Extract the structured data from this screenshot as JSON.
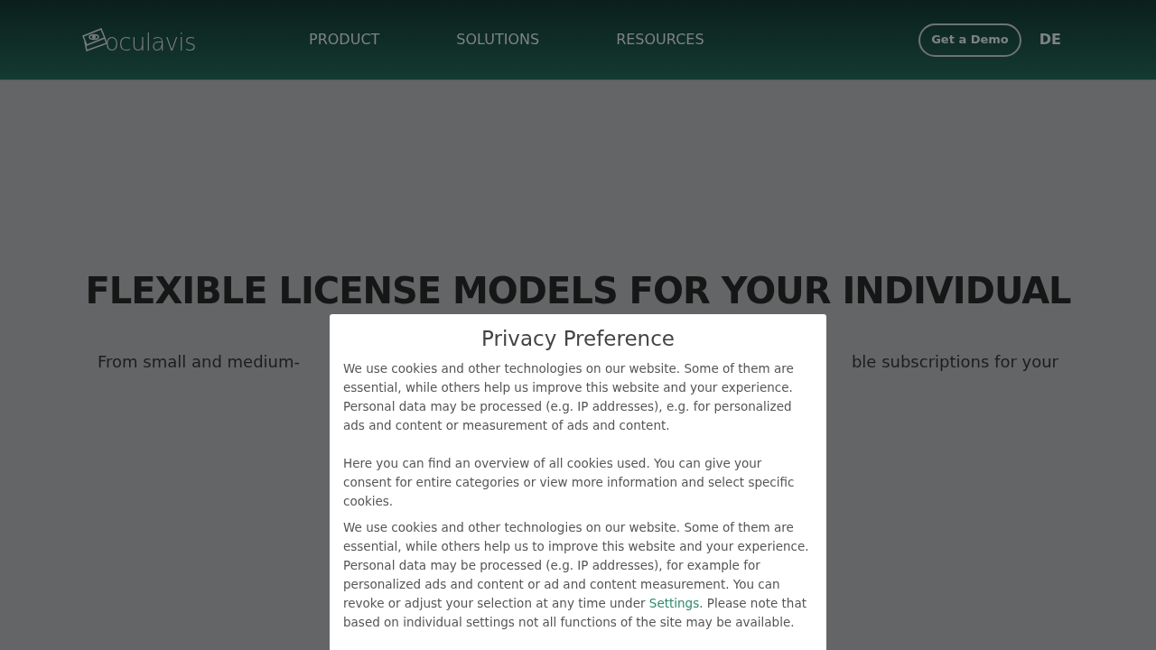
{
  "header": {
    "logo_text": "oculavis",
    "nav": [
      {
        "label": "PRODUCT"
      },
      {
        "label": "SOLUTIONS"
      },
      {
        "label": "RESOURCES"
      }
    ],
    "demo_button": "Get a Demo",
    "language": "DE"
  },
  "hero": {
    "heading": "FLEXIBLE LICENSE MODELS FOR YOUR INDIVIDUAL",
    "subtitle_left": "From small and medium-",
    "subtitle_right": "ble subscriptions for your"
  },
  "privacy_dialog": {
    "title": "Privacy Preference",
    "paragraphs": [
      "We use cookies and other technologies on our website. Some of them are essential, while others help us improve this website and your experience. Personal data may be processed (e.g. IP addresses), e.g. for personalized ads and content or measurement of ads and content.",
      "Here you can find an overview of all cookies used. You can give your consent for entire categories or view more information and select specific cookies."
    ],
    "notice": {
      "before": "We use cookies and other technologies on our website. Some of them are essential, while others help us to improve this website and your experience. Personal data may be processed (e.g. IP addresses), for example for personalized ads and content or ad and content measurement. You can revoke or adjust your selection at any time under",
      "link": "Settings",
      "after": ". Please note that based on individual settings not all functions of the site may be available."
    }
  }
}
